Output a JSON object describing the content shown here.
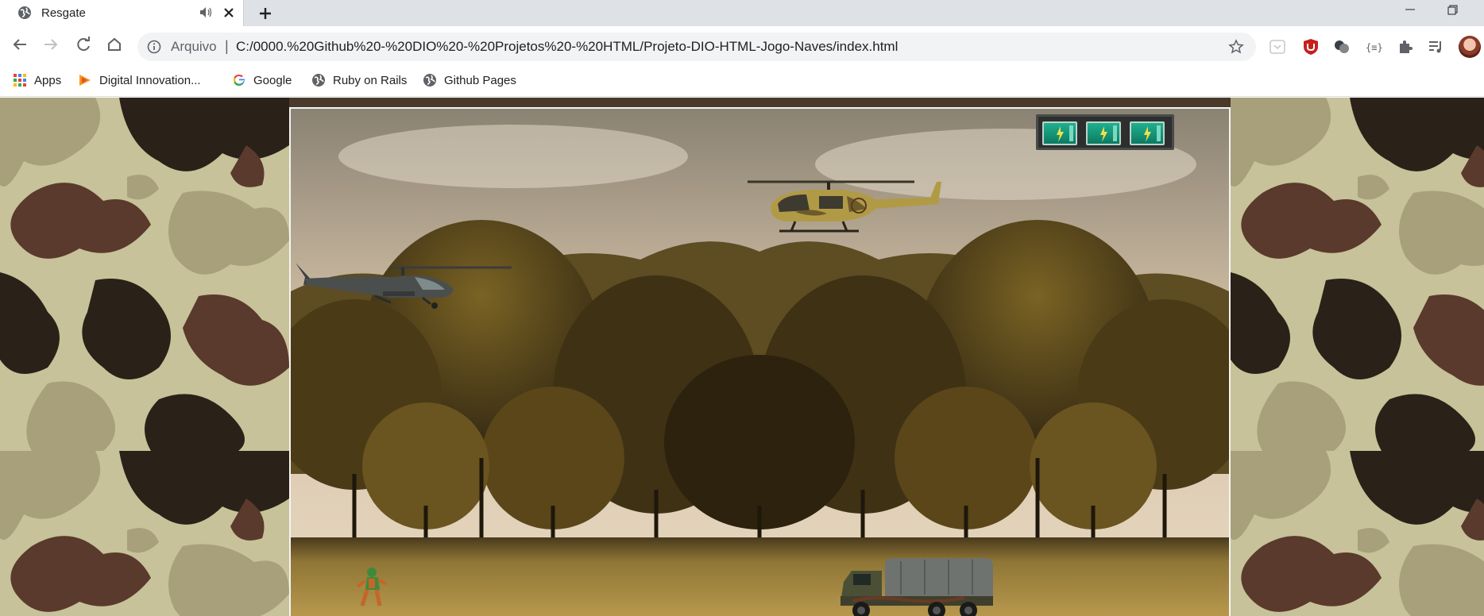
{
  "browser": {
    "tab": {
      "title": "Resgate",
      "favicon": "globe-icon"
    },
    "address": {
      "scheme_label": "Arquivo",
      "separator": "|",
      "url": "C:/0000.%20Github%20-%20DIO%20-%20Projetos%20-%20HTML/Projeto-DIO-HTML-Jogo-Naves/index.html"
    },
    "bookmarks": [
      {
        "label": "Apps",
        "icon": "apps-grid-icon"
      },
      {
        "label": "Digital Innovation...",
        "icon": "dio-icon"
      },
      {
        "label": "Google",
        "icon": "google-icon"
      },
      {
        "label": "Ruby on Rails",
        "icon": "globe-icon"
      },
      {
        "label": "Github Pages",
        "icon": "globe-icon"
      }
    ],
    "extensions": [
      "pocket-icon",
      "ublock-icon",
      "extension-icon",
      "json-viewer-icon",
      "puzzle-icon",
      "media-playlist-icon"
    ]
  },
  "game": {
    "energy_cells": 3,
    "colors": {
      "camo_base": "#c7c299",
      "camo_light": "#a8a07a",
      "camo_brown": "#5a3a2c",
      "camo_dark": "#2a2118",
      "energy_cell": "#1fb08e",
      "frame": "#f4f4f4"
    },
    "sprites": [
      "player-helicopter",
      "enemy-helicopter",
      "soldier",
      "army-truck"
    ]
  }
}
